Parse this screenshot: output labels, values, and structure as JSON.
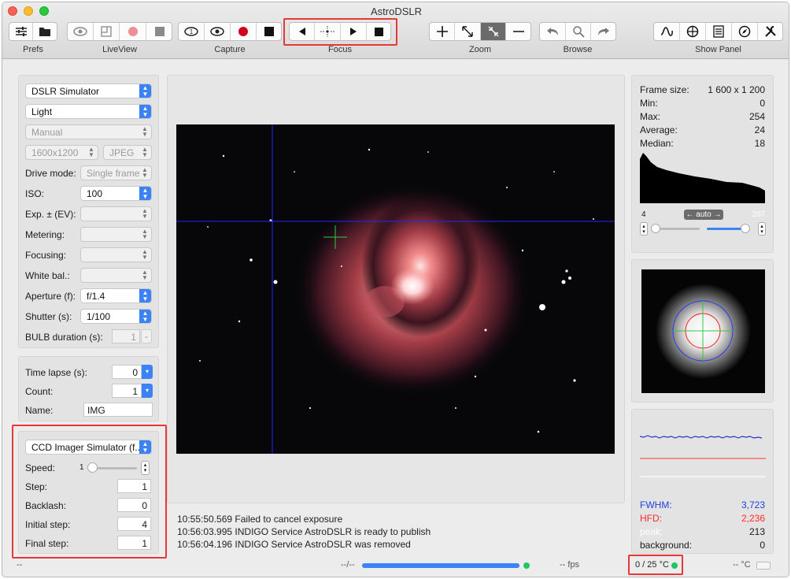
{
  "app": {
    "title": "AstroDSLR"
  },
  "toolbar": {
    "groups": {
      "prefs": "Prefs",
      "liveview": "LiveView",
      "capture": "Capture",
      "focus": "Focus",
      "zoom": "Zoom",
      "browse": "Browse",
      "show_panel": "Show Panel"
    }
  },
  "camera": {
    "device": "DSLR Simulator",
    "frame_type": "Light",
    "mode": "Manual",
    "resolution": "1600x1200",
    "format": "JPEG",
    "drive_mode_label": "Drive mode:",
    "drive_mode": "Single frame",
    "iso_label": "ISO:",
    "iso": "100",
    "exp_label": "Exp. ± (EV):",
    "metering_label": "Metering:",
    "focusing_label": "Focusing:",
    "white_bal_label": "White bal.:",
    "aperture_label": "Aperture (f):",
    "aperture": "f/1.4",
    "shutter_label": "Shutter (s):",
    "shutter": "1/100",
    "bulb_label": "BULB duration (s):",
    "bulb": "1"
  },
  "sequence": {
    "timelapse_label": "Time lapse (s):",
    "timelapse": "0",
    "count_label": "Count:",
    "count": "1",
    "name_label": "Name:",
    "name": "IMG"
  },
  "focuser": {
    "device": "CCD Imager Simulator (f...",
    "speed_label": "Speed:",
    "speed_min": "1",
    "step_label": "Step:",
    "step": "1",
    "backlash_label": "Backlash:",
    "backlash": "0",
    "initial_label": "Initial step:",
    "initial": "4",
    "final_label": "Final step:",
    "final": "1"
  },
  "stats": {
    "frame_size_label": "Frame size:",
    "frame_size": "1 600 x 1 200",
    "min_label": "Min:",
    "min": "0",
    "max_label": "Max:",
    "max": "254",
    "avg_label": "Average:",
    "avg": "24",
    "median_label": "Median:",
    "median": "18",
    "hist_low": "4",
    "hist_high": "207",
    "hist_mode": "← auto →"
  },
  "focus_stats": {
    "fwhm_label": "FWHM:",
    "fwhm": "3,723",
    "hfd_label": "HFD:",
    "hfd": "2,236",
    "peak_label": "peak:",
    "peak": "213",
    "background_label": "background:",
    "background": "0"
  },
  "log": [
    "10:55:50.569 Failed to cancel exposure",
    "10:56:03.995 INDIGO Service AstroDSLR is ready to publish",
    "10:56:04.196 INDIGO Service AstroDSLR was removed"
  ],
  "status": {
    "left": "--",
    "progress_text": "--/--",
    "progress": 1.0,
    "fps": "-- fps",
    "cooler": "0 / 25 °C",
    "temp": "-- °C"
  },
  "colors": {
    "accent": "#3b82f6",
    "highlight": "#e53935",
    "ok": "#22c55e"
  }
}
